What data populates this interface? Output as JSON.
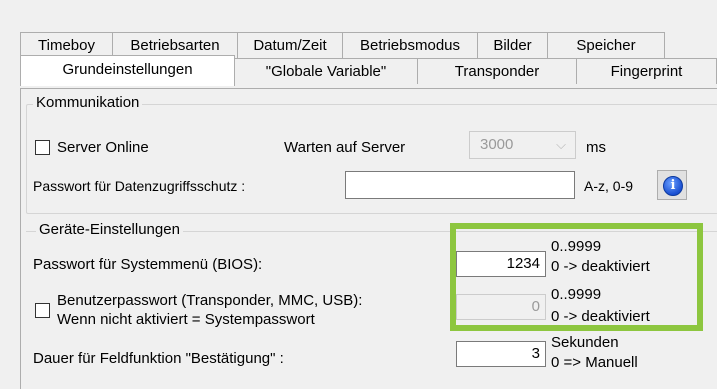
{
  "tabs_row1": [
    "Timeboy",
    "Betriebsarten",
    "Datum/Zeit",
    "Betriebsmodus",
    "Bilder",
    "Speicher"
  ],
  "tabs_row2": [
    "Grundeinstellungen",
    "\"Globale Variable\"",
    "Transponder",
    "Fingerprint"
  ],
  "active_tab": "Grundeinstellungen",
  "kommunikation": {
    "legend": "Kommunikation",
    "server_online_label": "Server Online",
    "server_online_checked": false,
    "warten_label": "Warten auf Server",
    "warten_value": "3000",
    "warten_unit": "ms",
    "passwort_label": "Passwort für Datenzugriffsschutz :",
    "passwort_value": "",
    "passwort_hint": "A-z, 0-9"
  },
  "geraete": {
    "legend": "Geräte-Einstellungen",
    "bios_label": "Passwort für Systemmenü (BIOS):",
    "bios_value": "1234",
    "bios_range": "0..9999",
    "bios_note": "0 -> deaktiviert",
    "benutzer_label_1": "Benutzerpasswort (Transponder, MMC, USB):",
    "benutzer_label_2": "Wenn nicht aktiviert = Systempasswort",
    "benutzer_checked": false,
    "benutzer_value": "0",
    "benutzer_range": "0..9999",
    "benutzer_note": "0 -> deaktiviert",
    "dauer_label": "Dauer für Feldfunktion \"Bestätigung\" :",
    "dauer_value": "3",
    "dauer_unit": "Sekunden",
    "dauer_note": "0 => Manuell"
  },
  "colors": {
    "highlight": "#8dc63f",
    "info_icon": "#1a4fd1"
  }
}
